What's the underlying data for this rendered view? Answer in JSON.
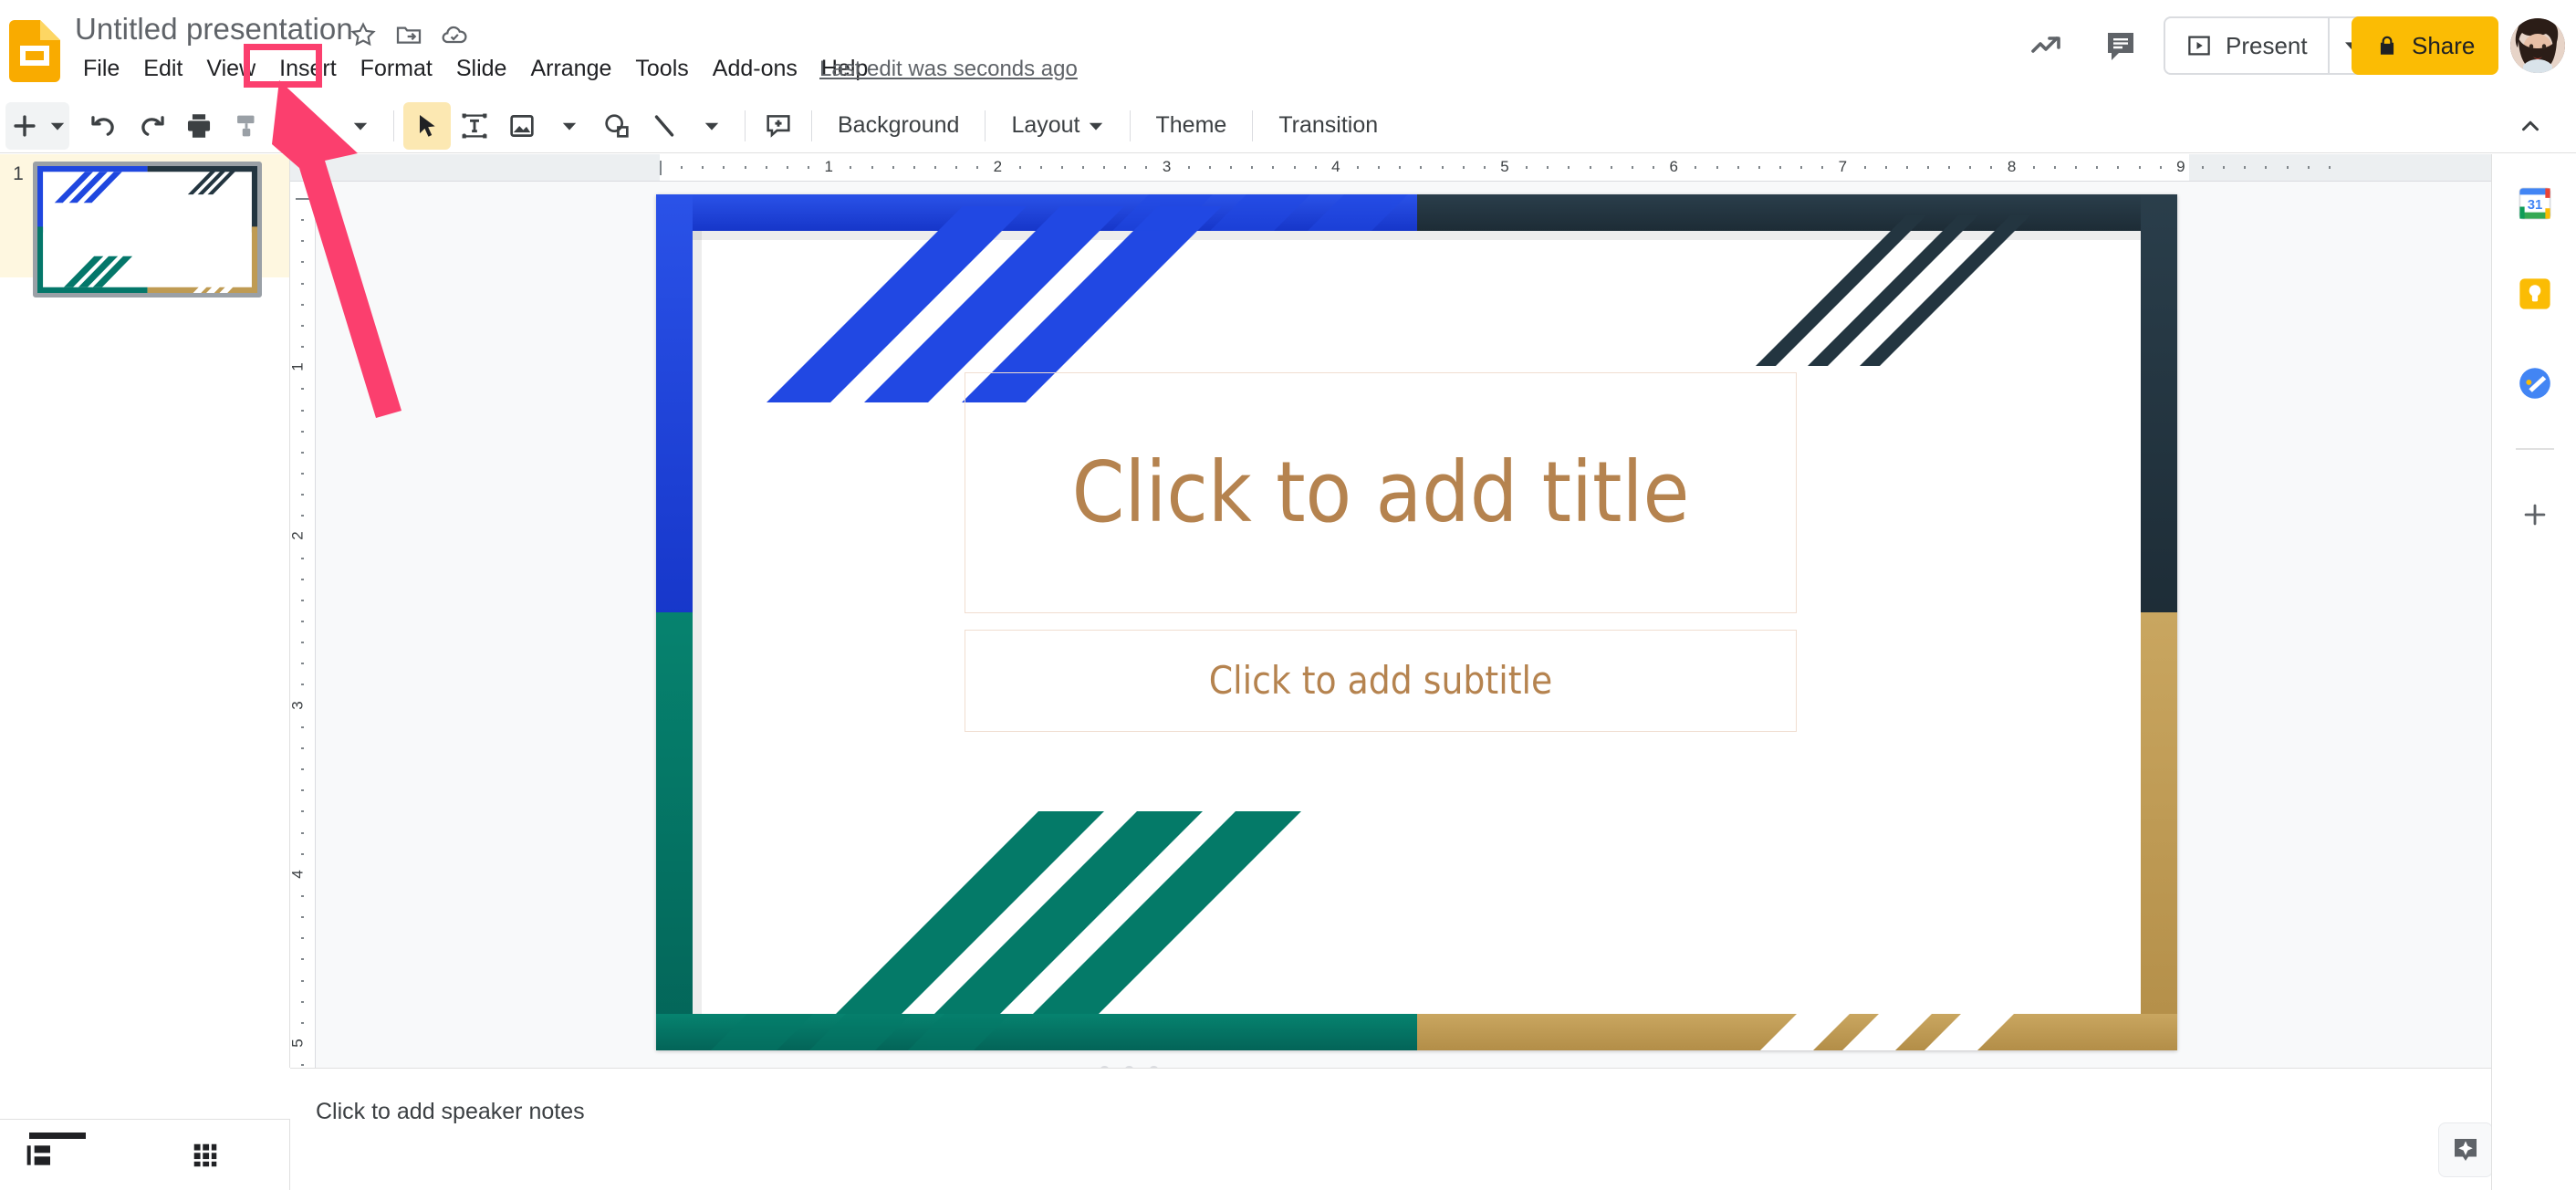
{
  "app": {
    "name": "Google Slides",
    "logo_icon": "slides-logo-icon"
  },
  "header": {
    "doc_title": "Untitled presentation",
    "title_icons": [
      {
        "name": "star-icon",
        "label": "Star"
      },
      {
        "name": "move-to-folder-icon",
        "label": "Move"
      },
      {
        "name": "cloud-saved-icon",
        "label": "See document status"
      }
    ],
    "menus": [
      {
        "label": "File",
        "highlighted": false
      },
      {
        "label": "Edit",
        "highlighted": false
      },
      {
        "label": "View",
        "highlighted": false
      },
      {
        "label": "Insert",
        "highlighted": true
      },
      {
        "label": "Format",
        "highlighted": false
      },
      {
        "label": "Slide",
        "highlighted": false
      },
      {
        "label": "Arrange",
        "highlighted": false
      },
      {
        "label": "Tools",
        "highlighted": false
      },
      {
        "label": "Add-ons",
        "highlighted": false
      },
      {
        "label": "Help",
        "highlighted": false
      }
    ],
    "last_edit": "Last edit was seconds ago",
    "activity_icon": "activity-dashboard-icon",
    "comment_icon": "comment-history-icon",
    "present_label": "Present",
    "present_icon": "present-play-icon",
    "present_caret_icon": "chevron-down-icon",
    "share_label": "Share",
    "share_lock_icon": "lock-icon",
    "avatar_name": "avatar"
  },
  "toolbar": {
    "new_slide_icon": "plus-icon",
    "new_slide_caret_icon": "chevron-down-icon",
    "undo_icon": "undo-icon",
    "redo_icon": "redo-icon",
    "print_icon": "print-icon",
    "paint_format_icon": "paint-format-icon",
    "zoom_icon": "zoom-in-icon",
    "zoom_caret_icon": "chevron-down-icon",
    "select_icon": "cursor-select-icon",
    "textbox_icon": "text-box-icon",
    "image_icon": "insert-image-icon",
    "image_caret_icon": "chevron-down-icon",
    "shape_icon": "shape-icon",
    "line_icon": "line-icon",
    "line_caret_icon": "chevron-down-icon",
    "comment_icon": "add-comment-icon",
    "background_label": "Background",
    "layout_label": "Layout",
    "layout_caret_icon": "chevron-down-icon",
    "theme_label": "Theme",
    "transition_label": "Transition",
    "collapse_icon": "chevron-up-icon"
  },
  "filmstrip": {
    "slides": [
      {
        "number": "1",
        "selected": true
      }
    ],
    "filmstrip_view_icon": "filmstrip-view-icon",
    "grid_view_icon": "grid-view-icon"
  },
  "rulers": {
    "horizontal_numbers": [
      "1",
      "2",
      "3",
      "4",
      "5",
      "6",
      "7",
      "8",
      "9"
    ],
    "vertical_numbers": [
      "1",
      "2",
      "3",
      "4",
      "5"
    ],
    "units": "inches"
  },
  "slide": {
    "title_placeholder": "Click to add title",
    "subtitle_placeholder": "Click to add subtitle",
    "theme_colors": {
      "blue": "#1f47df",
      "navy": "#233540",
      "teal": "#04776a",
      "gold": "#bf9b53",
      "placeholder_text": "#b5834f",
      "placeholder_border": "#f0ddd0"
    },
    "resize_grip_icon": "resize-grip-dots"
  },
  "notes": {
    "placeholder": "Click to add speaker notes",
    "explore_icon": "explore-sparkle-icon",
    "expand_icon": "chevron-right-icon"
  },
  "side_panel": {
    "items": [
      {
        "name": "calendar-side-icon",
        "label": "Calendar",
        "badge": "31"
      },
      {
        "name": "keep-side-icon",
        "label": "Keep"
      },
      {
        "name": "tasks-side-icon",
        "label": "Tasks"
      }
    ],
    "add_icon": "plus-icon"
  },
  "annotation": {
    "arrow_icon": "pointer-arrow-annotation",
    "arrow_color": "#fb3f6e",
    "target": "Insert",
    "highlight_color": "#fb3f6e"
  }
}
